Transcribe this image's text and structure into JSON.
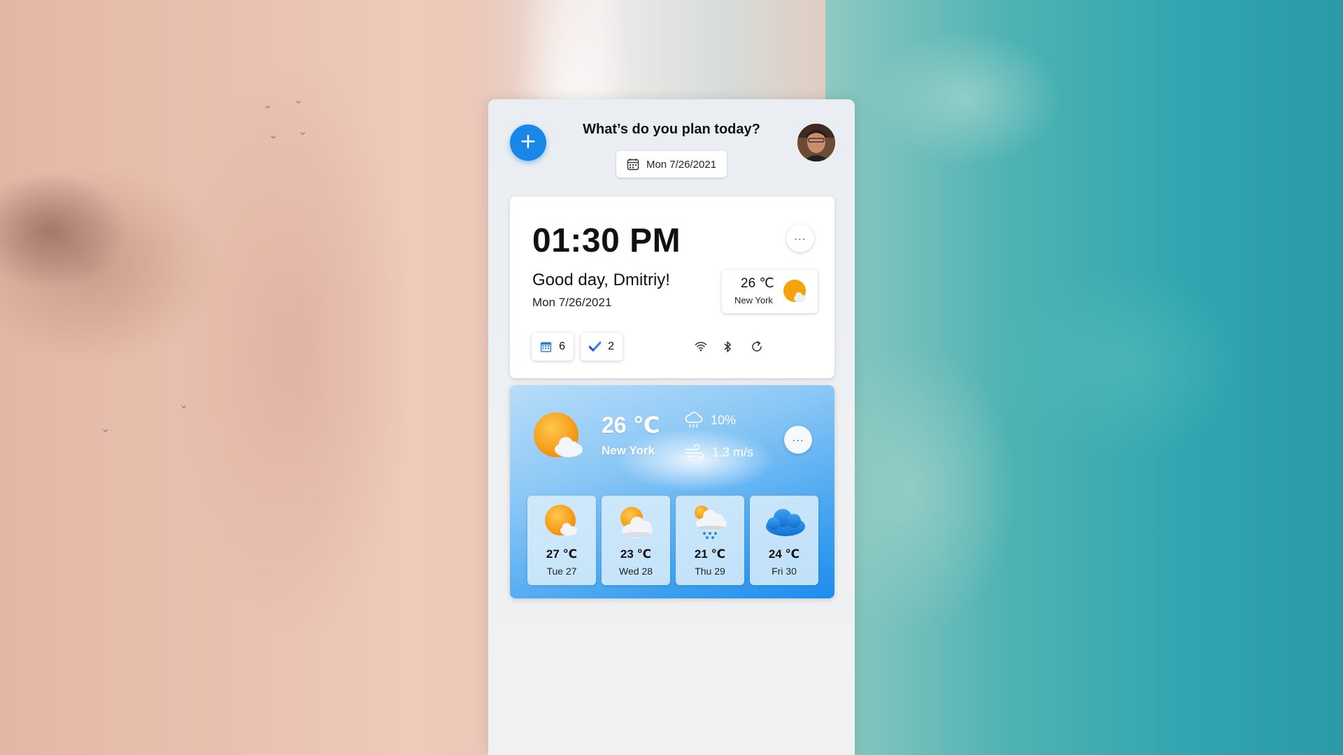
{
  "header": {
    "title": "What’s do you plan today?",
    "date": "Mon 7/26/2021",
    "add_icon": "plus-icon",
    "avatar": "user-avatar"
  },
  "clock": {
    "time": "01:30 PM",
    "greeting": "Good day, Dmitriy!",
    "date": "Mon 7/26/2021",
    "more_label": "···",
    "weather_temp": "26 ℃",
    "weather_city": "New York",
    "calendar_count": "6",
    "tasks_count": "2",
    "status_icons": [
      "wifi-icon",
      "bluetooth-icon",
      "refresh-icon"
    ]
  },
  "weather": {
    "temp": "26 ℃",
    "city": "New York",
    "precipitation": "10%",
    "wind": "1.3 m/s",
    "more_label": "···",
    "forecast": [
      {
        "temp": "27 ℃",
        "day": "Tue 27",
        "icon": "sun-cloud-icon"
      },
      {
        "temp": "23 ℃",
        "day": "Wed 28",
        "icon": "cloud-sun-icon"
      },
      {
        "temp": "21 ℃",
        "day": "Thu 29",
        "icon": "rain-cloud-icon"
      },
      {
        "temp": "24 ℃",
        "day": "Fri 30",
        "icon": "blue-cloud-icon"
      }
    ]
  },
  "colors": {
    "accent": "#1a86e8",
    "sun": "#f6a20a",
    "weather_gradient_start": "#b8ddf9",
    "weather_gradient_end": "#1e8ced"
  }
}
